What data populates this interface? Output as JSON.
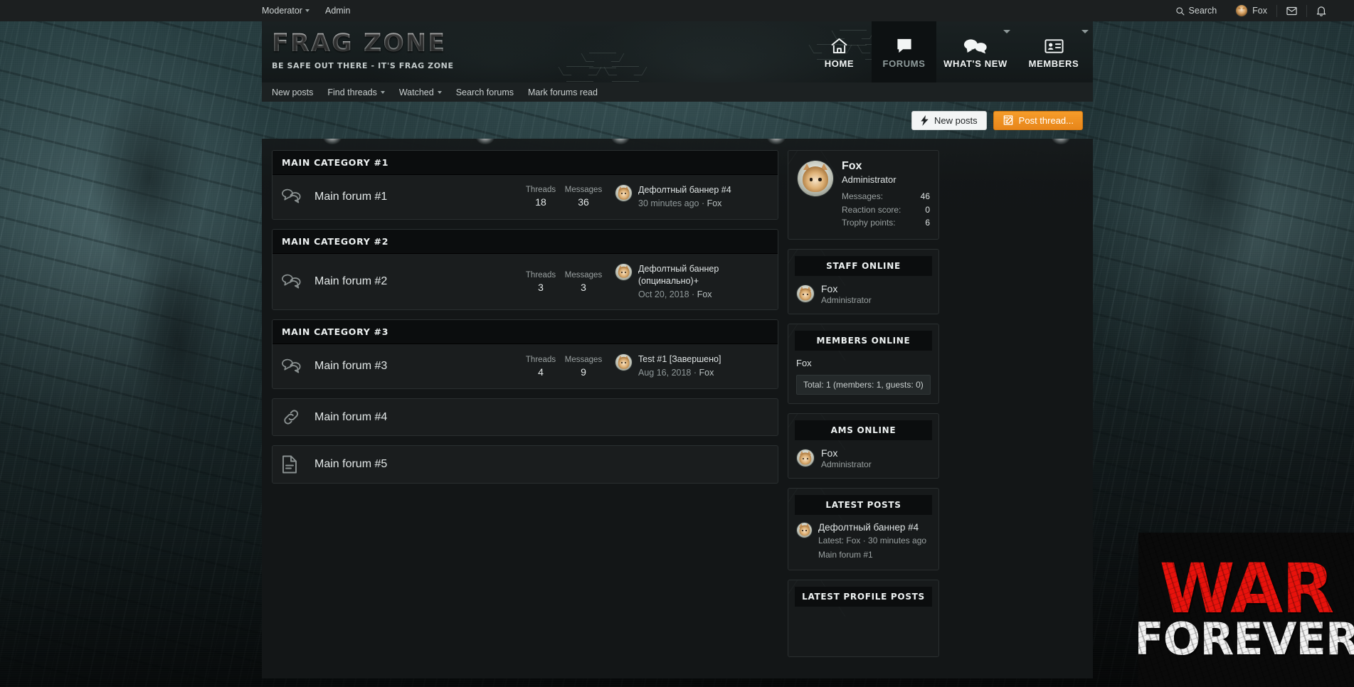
{
  "topbar": {
    "left_links": [
      {
        "label": "Moderator",
        "has_caret": true
      },
      {
        "label": "Admin",
        "has_caret": false
      }
    ],
    "search_label": "Search",
    "username": "Fox",
    "icons": [
      "search-icon",
      "mail-icon",
      "bell-icon"
    ]
  },
  "branding": {
    "title": "FRAG ZONE",
    "tagline": "BE SAFE OUT THERE - IT'S FRAG ZONE"
  },
  "main_nav": [
    {
      "label": "HOME",
      "icon": "home-icon",
      "active": false,
      "caret": false
    },
    {
      "label": "FORUMS",
      "icon": "speech-bubble-icon",
      "active": true,
      "caret": false
    },
    {
      "label": "WHAT'S NEW",
      "icon": "two-bubbles-icon",
      "active": false,
      "caret": true
    },
    {
      "label": "MEMBERS",
      "icon": "id-card-icon",
      "active": false,
      "caret": true
    }
  ],
  "sub_nav": [
    {
      "label": "New posts",
      "caret": false
    },
    {
      "label": "Find threads",
      "caret": true
    },
    {
      "label": "Watched",
      "caret": true
    },
    {
      "label": "Search forums",
      "caret": false
    },
    {
      "label": "Mark forums read",
      "caret": false
    }
  ],
  "action_bar": {
    "new_posts_label": "New posts",
    "post_thread_label": "Post thread...",
    "accent_color": "#ee8c1c"
  },
  "forum_stat_labels": {
    "threads": "Threads",
    "messages": "Messages"
  },
  "categories": [
    {
      "title": "MAIN CATEGORY #1",
      "forums": [
        {
          "name": "Main forum #1",
          "icon": "speech-bubbles-icon",
          "threads": "18",
          "messages": "36",
          "last_post_title": "Дефолтный баннер #4",
          "last_post_date": "30 minutes ago",
          "last_post_sep": " · ",
          "last_post_user": "Fox"
        }
      ]
    },
    {
      "title": "MAIN CATEGORY #2",
      "forums": [
        {
          "name": "Main forum #2",
          "icon": "speech-bubbles-icon",
          "threads": "3",
          "messages": "3",
          "last_post_title": "Дефолтный баннер (опцинально)+",
          "last_post_date": "Oct 20, 2018",
          "last_post_sep": " · ",
          "last_post_user": "Fox"
        }
      ]
    },
    {
      "title": "MAIN CATEGORY #3",
      "forums": [
        {
          "name": "Main forum #3",
          "icon": "speech-bubbles-icon",
          "threads": "4",
          "messages": "9",
          "last_post_title": "Test #1 [Завершено]",
          "last_post_date": "Aug 16, 2018",
          "last_post_sep": " · ",
          "last_post_user": "Fox"
        }
      ]
    }
  ],
  "solo_forums": [
    {
      "name": "Main forum #4",
      "icon": "link-chain-icon"
    },
    {
      "name": "Main forum #5",
      "icon": "page-document-icon"
    }
  ],
  "sidebar": {
    "profile": {
      "name": "Fox",
      "role": "Administrator",
      "stats": [
        {
          "label": "Messages:",
          "value": "46"
        },
        {
          "label": "Reaction score:",
          "value": "0"
        },
        {
          "label": "Trophy points:",
          "value": "6"
        }
      ]
    },
    "staff_online": {
      "title": "STAFF ONLINE",
      "members": [
        {
          "name": "Fox",
          "role": "Administrator"
        }
      ]
    },
    "members_online": {
      "title": "MEMBERS ONLINE",
      "members": [
        "Fox"
      ],
      "total": "Total: 1 (members: 1, guests: 0)"
    },
    "ams_online": {
      "title": "AMS ONLINE",
      "members": [
        {
          "name": "Fox",
          "role": "Administrator"
        }
      ]
    },
    "latest_posts": {
      "title": "LATEST POSTS",
      "items": [
        {
          "title": "Дефолтный баннер #4",
          "meta": "Latest: Fox · 30 minutes ago",
          "forum": "Main forum #1"
        }
      ]
    },
    "latest_profile_posts": {
      "title": "LATEST PROFILE POSTS"
    }
  },
  "ad_banner": {
    "line1": "WAR",
    "line2": "FOREVER",
    "line1_color": "#e8120c",
    "line2_color": "#f2f2f2"
  }
}
